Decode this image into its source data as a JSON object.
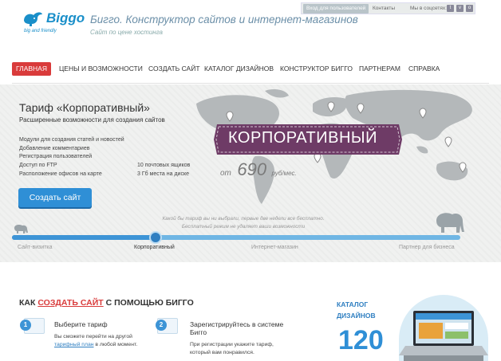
{
  "brand": {
    "name": "Biggo",
    "tagline": "big and friendly",
    "title": "Бигго. Конструктор сайтов и интернет-магазинов",
    "subtitle": "Сайт по цене хостинга",
    "color": "#1a8fc9"
  },
  "topbar": {
    "login": "Вход для пользователей",
    "contacts": "Контакты",
    "social_label": "Мы в соцсетях:",
    "social_icons": [
      "twitter-icon",
      "vk-icon",
      "odnoklassniki-icon"
    ]
  },
  "nav": {
    "items": [
      {
        "label": "ГЛАВНАЯ",
        "active": true
      },
      {
        "label": "ЦЕНЫ И ВОЗМОЖНОСТИ"
      },
      {
        "label": "СОЗДАТЬ САЙТ"
      },
      {
        "label": "КАТАЛОГ ДИЗАЙНОВ"
      },
      {
        "label": "КОНСТРУКТОР БИГГО"
      },
      {
        "label": "ПАРТНЕРАМ"
      },
      {
        "label": "СПРАВКА"
      }
    ],
    "active_color": "#d93b3b"
  },
  "hero": {
    "title": "Тариф «Корпоративный»",
    "subtitle": "Расширенные возможности для создания сайтов",
    "features": [
      {
        "label": "Модули для создания статей и новостей",
        "value": ""
      },
      {
        "label": "Добавление комментариев",
        "value": ""
      },
      {
        "label": "Регистрация пользователей",
        "value": ""
      },
      {
        "label": "Доступ по FTP",
        "value": "10 почтовых ящиков"
      },
      {
        "label": "Расположение офисов на карте",
        "value": "3 Гб места на диске"
      }
    ],
    "button": "Создать сайт",
    "banner": "КОРПОРАТИВНЫЙ",
    "price_from": "от",
    "price": "690",
    "price_unit": "руб/мес.",
    "hint_line1": "Какой бы тариф вы ни выбрали, первые две недели все бесплатно.",
    "hint_line2": "Бесплатный режим не удаляет ваши возможности",
    "banner_color": "#6e3b66"
  },
  "tariffs": {
    "items": [
      "Сайт-визитка",
      "Корпоративный",
      "Интернет-магазин",
      "Партнер для бизнеса"
    ],
    "selected": 1,
    "level": 0.32
  },
  "how": {
    "prefix": "КАК ",
    "highlight": "СОЗДАТЬ САЙТ",
    "suffix": " С ПОМОЩЬЮ БИГГО",
    "steps": [
      {
        "num": "1",
        "title": "Выберите тариф",
        "desc_a": "Вы сможете перейти на другой",
        "link": "тарифный план",
        "desc_b": " в любой момент."
      },
      {
        "num": "2",
        "title": "Зарегистрируйтесь в системе",
        "title2": "Бигго",
        "desc_a": "При регистрации укажите тариф,",
        "desc_b": "который вам понравился."
      }
    ]
  },
  "catalog": {
    "label1": "КАТАЛОГ",
    "label2": "ДИЗАЙНОВ",
    "count": "120"
  }
}
